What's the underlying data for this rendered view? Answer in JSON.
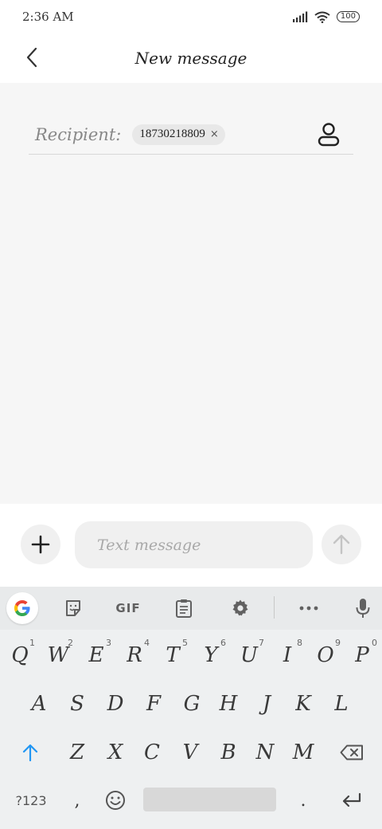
{
  "status_bar": {
    "time": "2:36 AM",
    "battery": "100"
  },
  "header": {
    "title": "New message",
    "back_icon": "chevron-left-icon"
  },
  "recipient": {
    "label": "Recipient:",
    "chip_value": "18730218809",
    "chip_remove": "×",
    "contact_icon": "person-icon"
  },
  "compose": {
    "placeholder": "Text message",
    "add_icon": "plus-icon",
    "send_icon": "arrow-up-icon"
  },
  "keyboard": {
    "toolbar": {
      "google_icon": "google-g-icon",
      "sticker_icon": "sticker-icon",
      "gif_label": "GIF",
      "clipboard_icon": "clipboard-icon",
      "settings_icon": "gear-icon",
      "more_icon": "more-horiz-icon",
      "mic_icon": "microphone-icon"
    },
    "row1": [
      {
        "key": "Q",
        "hint": "1"
      },
      {
        "key": "W",
        "hint": "2"
      },
      {
        "key": "E",
        "hint": "3"
      },
      {
        "key": "R",
        "hint": "4"
      },
      {
        "key": "T",
        "hint": "5"
      },
      {
        "key": "Y",
        "hint": "6"
      },
      {
        "key": "U",
        "hint": "7"
      },
      {
        "key": "I",
        "hint": "8"
      },
      {
        "key": "O",
        "hint": "9"
      },
      {
        "key": "P",
        "hint": "0"
      }
    ],
    "row2": [
      "A",
      "S",
      "D",
      "F",
      "G",
      "H",
      "J",
      "K",
      "L"
    ],
    "row3": [
      "Z",
      "X",
      "C",
      "V",
      "B",
      "N",
      "M"
    ],
    "shift_icon": "shift-arrow-up-icon",
    "backspace_icon": "backspace-icon",
    "row4": {
      "symbols": "?123",
      "comma": ",",
      "emoji_icon": "emoji-icon",
      "period": ".",
      "enter_icon": "enter-return-icon"
    }
  },
  "colors": {
    "accent": "#2196f3",
    "content_bg": "#f6f6f6",
    "keyboard_bg": "#eef0f1"
  }
}
